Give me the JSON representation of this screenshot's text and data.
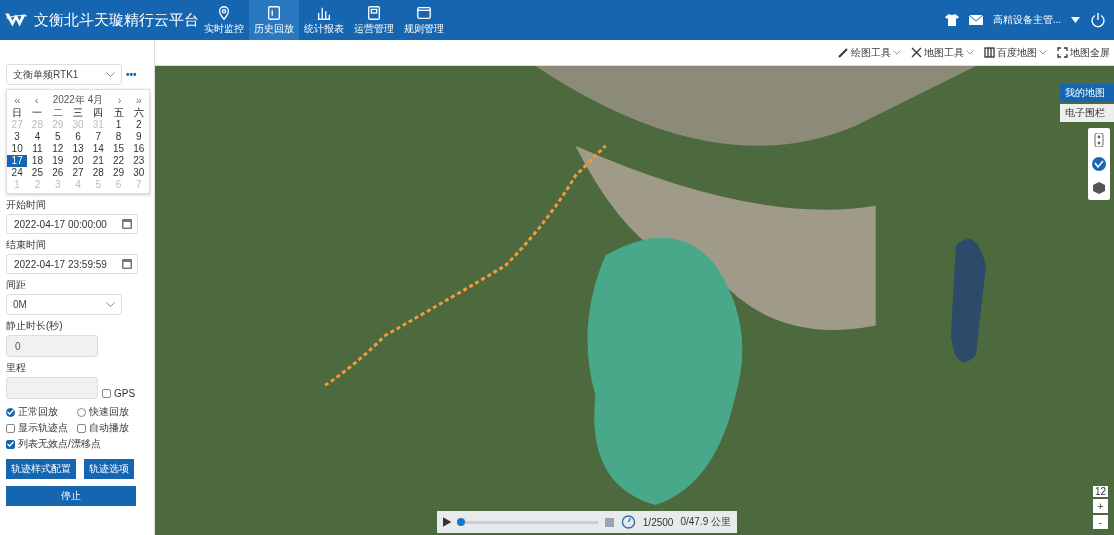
{
  "header": {
    "title": "文衡北斗天璇精行云平台",
    "nav": [
      {
        "label": "实时监控",
        "selected": false
      },
      {
        "label": "历史回放",
        "selected": true
      },
      {
        "label": "统计报表",
        "selected": false
      },
      {
        "label": "运营管理",
        "selected": false
      },
      {
        "label": "规则管理",
        "selected": false
      }
    ],
    "user": "高精设备主管..."
  },
  "sidebar": {
    "device": "文衡单频RTK1",
    "more": "•••",
    "calendar": {
      "prev_year": "«",
      "prev_month": "‹",
      "title": "2022年 4月",
      "next_month": "›",
      "next_year": "»",
      "weekdays": [
        "日",
        "一",
        "二",
        "三",
        "四",
        "五",
        "六"
      ],
      "days": [
        {
          "label": "27",
          "muted": true,
          "selected": false
        },
        {
          "label": "28",
          "muted": true,
          "selected": false
        },
        {
          "label": "29",
          "muted": true,
          "selected": false
        },
        {
          "label": "30",
          "muted": true,
          "selected": false
        },
        {
          "label": "31",
          "muted": true,
          "selected": false
        },
        {
          "label": "1",
          "muted": false,
          "selected": false
        },
        {
          "label": "2",
          "muted": false,
          "selected": false
        },
        {
          "label": "3",
          "muted": false,
          "selected": false
        },
        {
          "label": "4",
          "muted": false,
          "selected": false
        },
        {
          "label": "5",
          "muted": false,
          "selected": false
        },
        {
          "label": "6",
          "muted": false,
          "selected": false
        },
        {
          "label": "7",
          "muted": false,
          "selected": false
        },
        {
          "label": "8",
          "muted": false,
          "selected": false
        },
        {
          "label": "9",
          "muted": false,
          "selected": false
        },
        {
          "label": "10",
          "muted": false,
          "selected": false
        },
        {
          "label": "11",
          "muted": false,
          "selected": false
        },
        {
          "label": "12",
          "muted": false,
          "selected": false
        },
        {
          "label": "13",
          "muted": false,
          "selected": false
        },
        {
          "label": "14",
          "muted": false,
          "selected": false
        },
        {
          "label": "15",
          "muted": false,
          "selected": false
        },
        {
          "label": "16",
          "muted": false,
          "selected": false
        },
        {
          "label": "17",
          "muted": false,
          "selected": true
        },
        {
          "label": "18",
          "muted": false,
          "selected": false
        },
        {
          "label": "19",
          "muted": false,
          "selected": false
        },
        {
          "label": "20",
          "muted": false,
          "selected": false
        },
        {
          "label": "21",
          "muted": false,
          "selected": false
        },
        {
          "label": "22",
          "muted": false,
          "selected": false
        },
        {
          "label": "23",
          "muted": false,
          "selected": false
        },
        {
          "label": "24",
          "muted": false,
          "selected": false
        },
        {
          "label": "25",
          "muted": false,
          "selected": false
        },
        {
          "label": "26",
          "muted": false,
          "selected": false
        },
        {
          "label": "27",
          "muted": false,
          "selected": false
        },
        {
          "label": "28",
          "muted": false,
          "selected": false
        },
        {
          "label": "29",
          "muted": false,
          "selected": false
        },
        {
          "label": "30",
          "muted": false,
          "selected": false
        },
        {
          "label": "1",
          "muted": true,
          "selected": false
        },
        {
          "label": "2",
          "muted": true,
          "selected": false
        },
        {
          "label": "3",
          "muted": true,
          "selected": false
        },
        {
          "label": "4",
          "muted": true,
          "selected": false
        },
        {
          "label": "5",
          "muted": true,
          "selected": false
        },
        {
          "label": "6",
          "muted": true,
          "selected": false
        },
        {
          "label": "7",
          "muted": true,
          "selected": false
        }
      ]
    },
    "start_label": "开始时间",
    "start_value": "2022-04-17 00:00:00",
    "end_label": "结束时间",
    "end_value": "2022-04-17 23:59:59",
    "interval_label": "间距",
    "interval_value": "0M",
    "stop_label": "静止时长(秒)",
    "stop_value": "0",
    "mileage_label": "里程",
    "gps": {
      "label": "GPS",
      "checked": false
    },
    "options": [
      {
        "kind": "radio",
        "label": "正常回放",
        "checked": true
      },
      {
        "kind": "radio",
        "label": "快速回放",
        "checked": false
      },
      {
        "kind": "checkbox",
        "label": "显示轨迹点",
        "checked": false
      },
      {
        "kind": "checkbox",
        "label": "自动播放",
        "checked": false
      },
      {
        "kind": "checkbox",
        "label": "列表无效点/漂移点",
        "checked": true
      }
    ],
    "buttons": [
      "轨迹样式配置",
      "轨迹选项"
    ],
    "stop_button": "停止"
  },
  "map_toolbar": [
    {
      "label": "绘图工具"
    },
    {
      "label": "地图工具"
    },
    {
      "label": "百度地图"
    },
    {
      "label": "地图全屏"
    }
  ],
  "map": {
    "layers": [
      {
        "label": "我的地图",
        "selected": true
      },
      {
        "label": "电子围栏",
        "selected": false
      }
    ],
    "zoom_level": "12",
    "zoom_in": "+",
    "zoom_out": "-",
    "player": {
      "level": 0.02,
      "speed": "1/2500",
      "distance": "0/47.9 公里"
    }
  }
}
